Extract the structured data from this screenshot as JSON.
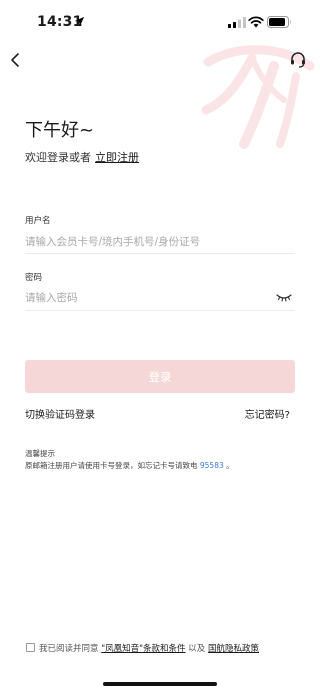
{
  "status_bar": {
    "time": "14:31"
  },
  "greeting": "下午好~",
  "welcome": {
    "text": "欢迎登录或者",
    "register_link": "立即注册"
  },
  "username": {
    "label": "用户名",
    "placeholder": "请输入会员卡号/境内手机号/身份证号",
    "value": ""
  },
  "password": {
    "label": "密码",
    "placeholder": "请输入密码",
    "value": ""
  },
  "login_button": "登录",
  "sms_login": "切换验证码登录",
  "forgot_password": "忘记密码?",
  "tips": {
    "title": "温馨提示",
    "body": "原邮箱注册用户请使用卡号登录，如忘记卡号请致电",
    "phone": "95583",
    "suffix": "。"
  },
  "agreement": {
    "prefix": "我已阅读并同意",
    "terms_link": "\"凤凰知音\"条款和条件",
    "conjunction": "以及",
    "privacy_link": "国航隐私政策"
  },
  "colors": {
    "accent": "#e3242b",
    "button_disabled": "#f6d7d8",
    "link_blue": "#3b7dd8"
  },
  "icons": [
    "location-arrow-icon",
    "signal-icon",
    "wifi-icon",
    "battery-icon",
    "back-icon",
    "customer-service-icon",
    "eye-closed-icon",
    "air-china-logo"
  ]
}
